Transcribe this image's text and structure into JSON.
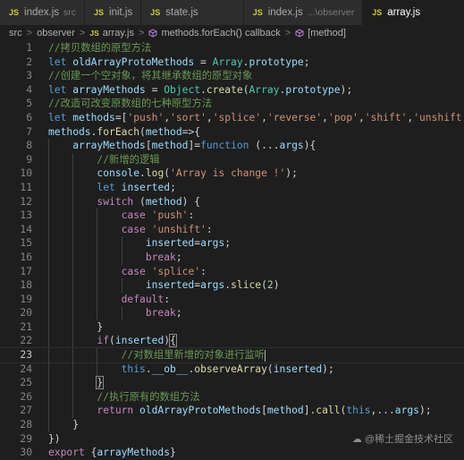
{
  "tabs": [
    {
      "icon": "JS",
      "label": "index.js",
      "desc": "src",
      "active": false
    },
    {
      "icon": "JS",
      "label": "init.js",
      "desc": "",
      "active": false
    },
    {
      "icon": "JS",
      "label": "state.js",
      "desc": "",
      "active": false
    },
    {
      "icon": "JS",
      "label": "index.js",
      "desc": "...\\observer",
      "active": false
    },
    {
      "icon": "JS",
      "label": "array.js",
      "desc": "",
      "active": true
    }
  ],
  "breadcrumb": {
    "items": [
      "src",
      "observer",
      "array.js",
      "methods.forEach() callback",
      "[method]"
    ],
    "file_icon": "JS",
    "method_icon": "cube-icon",
    "separator": ">"
  },
  "code": {
    "current_line": 23,
    "lines": [
      {
        "n": "1",
        "tokens": [
          {
            "t": "//拷贝数组的原型方法",
            "c": "c"
          }
        ]
      },
      {
        "n": "2",
        "tokens": [
          {
            "t": "let ",
            "c": "k"
          },
          {
            "t": "oldArrayProtoMethods",
            "c": "v"
          },
          {
            "t": " = ",
            "c": "p"
          },
          {
            "t": "Array",
            "c": "t"
          },
          {
            "t": ".",
            "c": "p"
          },
          {
            "t": "prototype",
            "c": "v"
          },
          {
            "t": ";",
            "c": "p"
          }
        ]
      },
      {
        "n": "3",
        "tokens": [
          {
            "t": "//创建一个空对象，将其继承数组的原型对象",
            "c": "c"
          }
        ]
      },
      {
        "n": "4",
        "tokens": [
          {
            "t": "let ",
            "c": "k"
          },
          {
            "t": "arrayMethods",
            "c": "v"
          },
          {
            "t": " = ",
            "c": "p"
          },
          {
            "t": "Object",
            "c": "t"
          },
          {
            "t": ".",
            "c": "p"
          },
          {
            "t": "create",
            "c": "f"
          },
          {
            "t": "(",
            "c": "p"
          },
          {
            "t": "Array",
            "c": "t"
          },
          {
            "t": ".",
            "c": "p"
          },
          {
            "t": "prototype",
            "c": "v"
          },
          {
            "t": ");",
            "c": "p"
          }
        ]
      },
      {
        "n": "5",
        "tokens": [
          {
            "t": "//改造可改变原数组的七种原型方法",
            "c": "c"
          }
        ]
      },
      {
        "n": "6",
        "tokens": [
          {
            "t": "let ",
            "c": "k"
          },
          {
            "t": "methods",
            "c": "v"
          },
          {
            "t": "=[",
            "c": "p"
          },
          {
            "t": "'push'",
            "c": "s"
          },
          {
            "t": ",",
            "c": "p"
          },
          {
            "t": "'sort'",
            "c": "s"
          },
          {
            "t": ",",
            "c": "p"
          },
          {
            "t": "'splice'",
            "c": "s"
          },
          {
            "t": ",",
            "c": "p"
          },
          {
            "t": "'reverse'",
            "c": "s"
          },
          {
            "t": ",",
            "c": "p"
          },
          {
            "t": "'pop'",
            "c": "s"
          },
          {
            "t": ",",
            "c": "p"
          },
          {
            "t": "'shift'",
            "c": "s"
          },
          {
            "t": ",",
            "c": "p"
          },
          {
            "t": "'unshift'",
            "c": "s"
          },
          {
            "t": "];",
            "c": "p"
          }
        ]
      },
      {
        "n": "7",
        "tokens": [
          {
            "t": "methods",
            "c": "v"
          },
          {
            "t": ".",
            "c": "p"
          },
          {
            "t": "forEach",
            "c": "f"
          },
          {
            "t": "(",
            "c": "p"
          },
          {
            "t": "method",
            "c": "v"
          },
          {
            "t": "=>{",
            "c": "p"
          }
        ]
      },
      {
        "n": "8",
        "tokens": [
          {
            "t": "    ",
            "c": "p"
          },
          {
            "t": "arrayMethods",
            "c": "v"
          },
          {
            "t": "[",
            "c": "p"
          },
          {
            "t": "method",
            "c": "v"
          },
          {
            "t": "]=",
            "c": "p"
          },
          {
            "t": "function",
            "c": "k"
          },
          {
            "t": " (...",
            "c": "p"
          },
          {
            "t": "args",
            "c": "v"
          },
          {
            "t": "){",
            "c": "p"
          }
        ]
      },
      {
        "n": "9",
        "tokens": [
          {
            "t": "        ",
            "c": "p"
          },
          {
            "t": "//新增的逻辑",
            "c": "c"
          }
        ]
      },
      {
        "n": "10",
        "tokens": [
          {
            "t": "        ",
            "c": "p"
          },
          {
            "t": "console",
            "c": "v"
          },
          {
            "t": ".",
            "c": "p"
          },
          {
            "t": "log",
            "c": "f"
          },
          {
            "t": "(",
            "c": "p"
          },
          {
            "t": "'Array is change !'",
            "c": "s"
          },
          {
            "t": ");",
            "c": "p"
          }
        ]
      },
      {
        "n": "11",
        "tokens": [
          {
            "t": "        ",
            "c": "p"
          },
          {
            "t": "let ",
            "c": "k"
          },
          {
            "t": "inserted",
            "c": "v"
          },
          {
            "t": ";",
            "c": "p"
          }
        ]
      },
      {
        "n": "12",
        "tokens": [
          {
            "t": "        ",
            "c": "p"
          },
          {
            "t": "switch",
            "c": "kc"
          },
          {
            "t": " (",
            "c": "p"
          },
          {
            "t": "method",
            "c": "v"
          },
          {
            "t": ") {",
            "c": "p"
          }
        ]
      },
      {
        "n": "13",
        "tokens": [
          {
            "t": "            ",
            "c": "p"
          },
          {
            "t": "case ",
            "c": "kc"
          },
          {
            "t": "'push'",
            "c": "s"
          },
          {
            "t": ":",
            "c": "p"
          }
        ]
      },
      {
        "n": "14",
        "tokens": [
          {
            "t": "            ",
            "c": "p"
          },
          {
            "t": "case ",
            "c": "kc"
          },
          {
            "t": "'unshift'",
            "c": "s"
          },
          {
            "t": ":",
            "c": "p"
          }
        ]
      },
      {
        "n": "15",
        "tokens": [
          {
            "t": "                ",
            "c": "p"
          },
          {
            "t": "inserted",
            "c": "v"
          },
          {
            "t": "=",
            "c": "p"
          },
          {
            "t": "args",
            "c": "v"
          },
          {
            "t": ";",
            "c": "p"
          }
        ]
      },
      {
        "n": "16",
        "tokens": [
          {
            "t": "                ",
            "c": "p"
          },
          {
            "t": "break",
            "c": "kc"
          },
          {
            "t": ";",
            "c": "p"
          }
        ]
      },
      {
        "n": "17",
        "tokens": [
          {
            "t": "            ",
            "c": "p"
          },
          {
            "t": "case ",
            "c": "kc"
          },
          {
            "t": "'splice'",
            "c": "s"
          },
          {
            "t": ":",
            "c": "p"
          }
        ]
      },
      {
        "n": "18",
        "tokens": [
          {
            "t": "                ",
            "c": "p"
          },
          {
            "t": "inserted",
            "c": "v"
          },
          {
            "t": "=",
            "c": "p"
          },
          {
            "t": "args",
            "c": "v"
          },
          {
            "t": ".",
            "c": "p"
          },
          {
            "t": "slice",
            "c": "f"
          },
          {
            "t": "(",
            "c": "p"
          },
          {
            "t": "2",
            "c": "n"
          },
          {
            "t": ")",
            "c": "p"
          }
        ]
      },
      {
        "n": "19",
        "tokens": [
          {
            "t": "            ",
            "c": "p"
          },
          {
            "t": "default",
            "c": "kc"
          },
          {
            "t": ":",
            "c": "p"
          }
        ]
      },
      {
        "n": "20",
        "tokens": [
          {
            "t": "                ",
            "c": "p"
          },
          {
            "t": "break",
            "c": "kc"
          },
          {
            "t": ";",
            "c": "p"
          }
        ]
      },
      {
        "n": "21",
        "tokens": [
          {
            "t": "        }",
            "c": "p"
          }
        ]
      },
      {
        "n": "22",
        "tokens": [
          {
            "t": "        ",
            "c": "p"
          },
          {
            "t": "if",
            "c": "kc"
          },
          {
            "t": "(",
            "c": "p"
          },
          {
            "t": "inserted",
            "c": "v"
          },
          {
            "t": ")",
            "c": "p"
          },
          {
            "t": "{",
            "c": "p",
            "br": true
          }
        ]
      },
      {
        "n": "23",
        "tokens": [
          {
            "t": "            ",
            "c": "p"
          },
          {
            "t": "//对数组里新增的对象进行监听",
            "c": "c"
          },
          {
            "t": "",
            "c": "caret"
          }
        ]
      },
      {
        "n": "24",
        "tokens": [
          {
            "t": "            ",
            "c": "p"
          },
          {
            "t": "this",
            "c": "k"
          },
          {
            "t": ".",
            "c": "p"
          },
          {
            "t": "__ob__",
            "c": "v"
          },
          {
            "t": ".",
            "c": "p"
          },
          {
            "t": "observeArray",
            "c": "f"
          },
          {
            "t": "(",
            "c": "p"
          },
          {
            "t": "inserted",
            "c": "v"
          },
          {
            "t": ");",
            "c": "p"
          }
        ]
      },
      {
        "n": "25",
        "tokens": [
          {
            "t": "        ",
            "c": "p"
          },
          {
            "t": "}",
            "c": "p",
            "br": true
          }
        ]
      },
      {
        "n": "26",
        "tokens": [
          {
            "t": "        ",
            "c": "p"
          },
          {
            "t": "//执行原有的数组方法",
            "c": "c"
          }
        ]
      },
      {
        "n": "27",
        "tokens": [
          {
            "t": "        ",
            "c": "p"
          },
          {
            "t": "return ",
            "c": "kc"
          },
          {
            "t": "oldArrayProtoMethods",
            "c": "v"
          },
          {
            "t": "[",
            "c": "p"
          },
          {
            "t": "method",
            "c": "v"
          },
          {
            "t": "].",
            "c": "p"
          },
          {
            "t": "call",
            "c": "f"
          },
          {
            "t": "(",
            "c": "p"
          },
          {
            "t": "this",
            "c": "k"
          },
          {
            "t": ",...",
            "c": "p"
          },
          {
            "t": "args",
            "c": "v"
          },
          {
            "t": ");",
            "c": "p"
          }
        ]
      },
      {
        "n": "28",
        "tokens": [
          {
            "t": "    }",
            "c": "p"
          }
        ]
      },
      {
        "n": "29",
        "tokens": [
          {
            "t": "})",
            "c": "p"
          }
        ]
      },
      {
        "n": "30",
        "tokens": [
          {
            "t": "export ",
            "c": "kc"
          },
          {
            "t": "{",
            "c": "p"
          },
          {
            "t": "arrayMethods",
            "c": "v"
          },
          {
            "t": "}",
            "c": "p"
          }
        ]
      }
    ]
  },
  "watermark": {
    "logo": "☁",
    "text": "@稀土掘金技术社区"
  },
  "colors": {
    "background": "#1e1e1e",
    "tab_bar": "#252526",
    "comment": "#6a9955",
    "keyword": "#569cd6",
    "control": "#c586c0",
    "variable": "#9cdcfe",
    "function": "#dcdcaa",
    "type": "#4ec9b0",
    "string": "#ce9178",
    "number": "#b5cea8",
    "js_icon": "#cbcb41"
  }
}
